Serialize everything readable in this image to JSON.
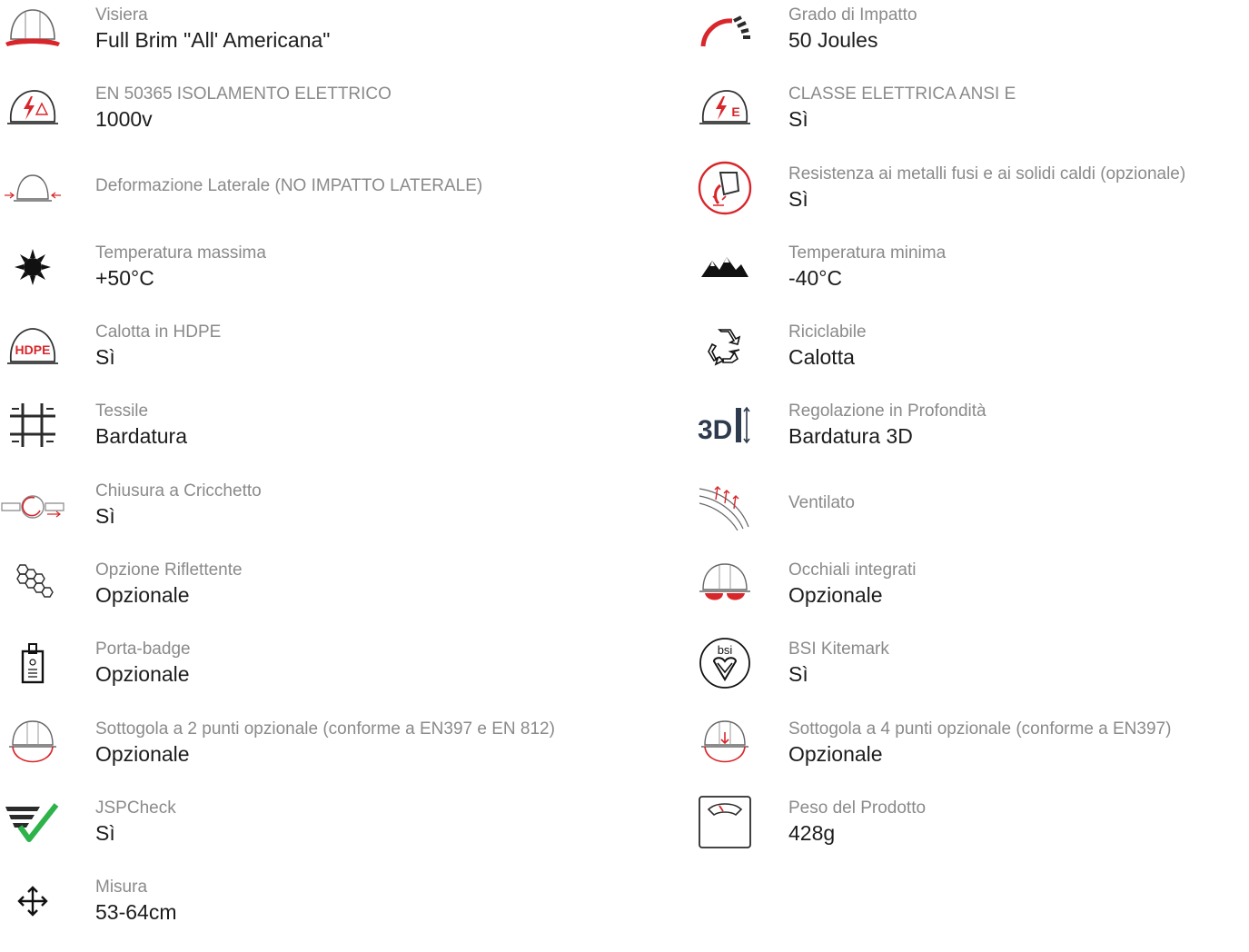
{
  "colors": {
    "accent_red": "#d8262b",
    "icon_dark": "#2b2b2b",
    "label_gray": "#8a8a8a",
    "check_green": "#2eb34a"
  },
  "left_items": [
    {
      "icon": "visor-helmet-icon",
      "label": "Visiera",
      "value": "Full Brim \"All' Americana\""
    },
    {
      "icon": "electrical-insulation-icon",
      "label": "EN 50365 ISOLAMENTO ELETTRICO",
      "value": "1000v"
    },
    {
      "icon": "lateral-deformation-icon",
      "label": "Deformazione Laterale (NO IMPATTO LATERALE)",
      "value": ""
    },
    {
      "icon": "sun-icon",
      "label": "Temperatura massima",
      "value": "+50°C"
    },
    {
      "icon": "hdpe-helmet-icon",
      "label": "Calotta in HDPE",
      "value": "Sì"
    },
    {
      "icon": "textile-icon",
      "label": "Tessile",
      "value": "Bardatura"
    },
    {
      "icon": "ratchet-icon",
      "label": "Chiusura a Cricchetto",
      "value": "Sì"
    },
    {
      "icon": "reflective-hex-icon",
      "label": "Opzione Riflettente",
      "value": "Opzionale"
    },
    {
      "icon": "badge-holder-icon",
      "label": "Porta-badge",
      "value": "Opzionale"
    },
    {
      "icon": "chinstrap-2pt-icon",
      "label": "Sottogola a 2 punti opzionale (conforme a EN397 e EN 812)",
      "value": "Opzionale"
    },
    {
      "icon": "jspcheck-icon",
      "label": "JSPCheck",
      "value": "Sì"
    },
    {
      "icon": "size-arrows-icon",
      "label": "Misura",
      "value": "53-64cm"
    }
  ],
  "right_items": [
    {
      "icon": "impact-gauge-icon",
      "label": "Grado di Impatto",
      "value": "50 Joules"
    },
    {
      "icon": "electrical-class-e-icon",
      "label": "CLASSE ELETTRICA ANSI E",
      "value": "Sì"
    },
    {
      "icon": "molten-metal-icon",
      "label": "Resistenza ai metalli fusi e ai solidi caldi (opzionale)",
      "value": "Sì"
    },
    {
      "icon": "mountains-icon",
      "label": "Temperatura minima",
      "value": "-40°C"
    },
    {
      "icon": "recycle-icon",
      "label": "Riciclabile",
      "value": "Calotta"
    },
    {
      "icon": "3d-adjust-icon",
      "label": "Regolazione in Profondità",
      "value": "Bardatura 3D"
    },
    {
      "icon": "ventilated-icon",
      "label": "Ventilato",
      "value": ""
    },
    {
      "icon": "integrated-goggles-icon",
      "label": "Occhiali integrati",
      "value": "Opzionale"
    },
    {
      "icon": "bsi-kitemark-icon",
      "label": "BSI Kitemark",
      "value": "Sì"
    },
    {
      "icon": "chinstrap-4pt-icon",
      "label": "Sottogola a 4 punti opzionale (conforme a EN397)",
      "value": "Opzionale"
    },
    {
      "icon": "scale-icon",
      "label": "Peso del Prodotto",
      "value": "428g"
    }
  ]
}
